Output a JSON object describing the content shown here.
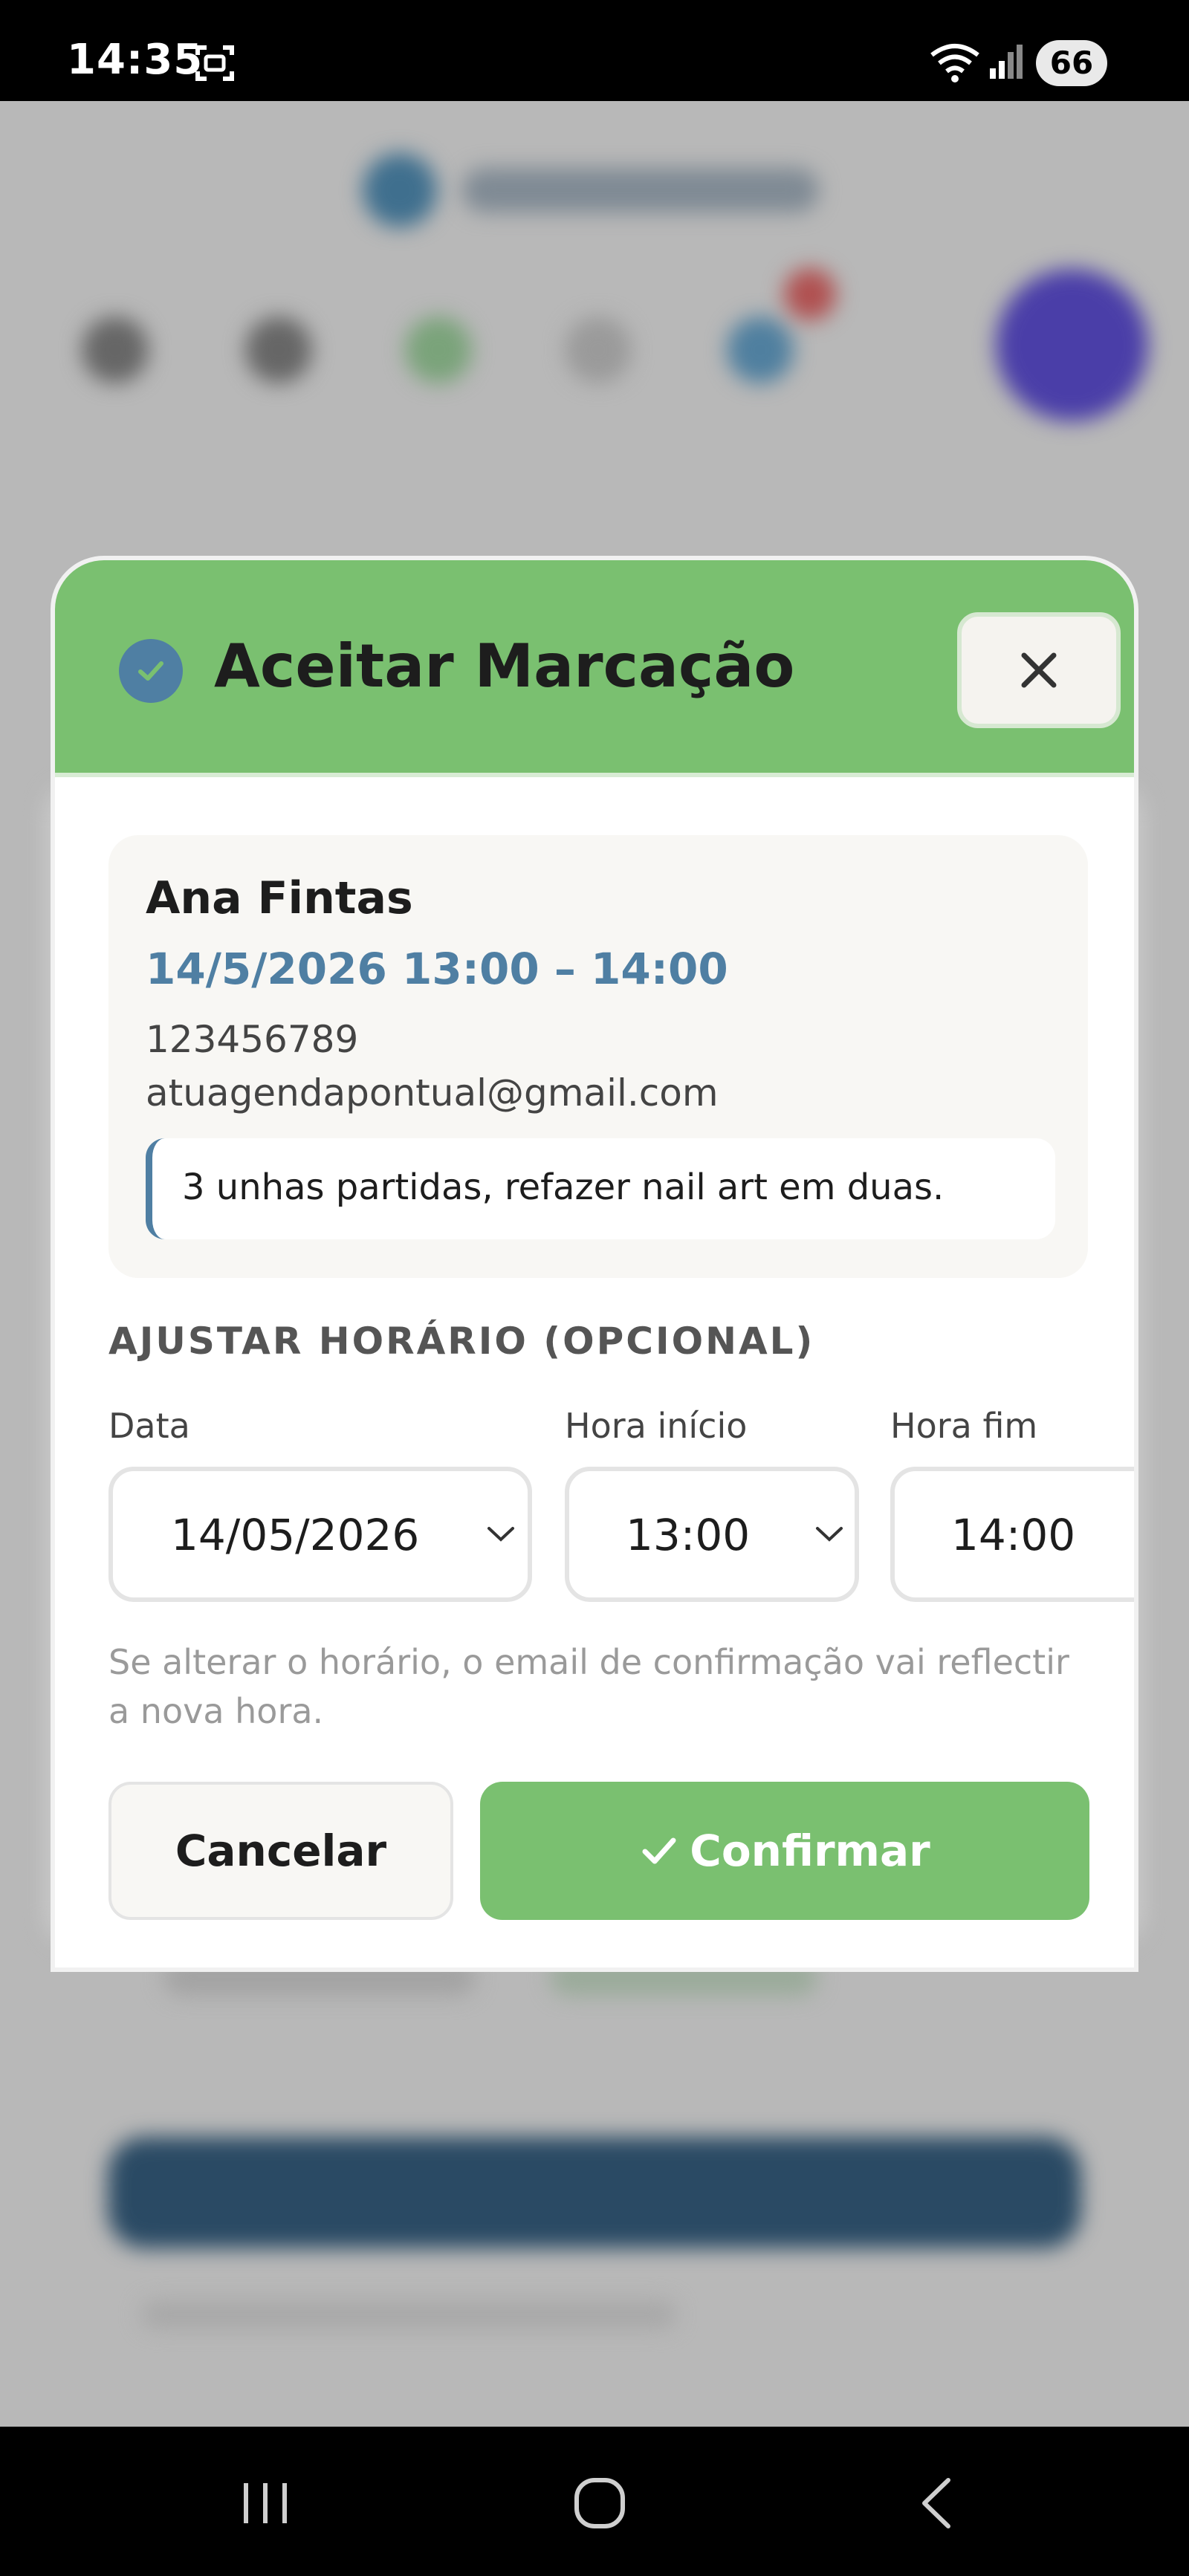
{
  "status_bar": {
    "time": "14:35",
    "battery": "66",
    "icons": [
      "screenshot-icon",
      "wifi-icon",
      "signal-icon"
    ]
  },
  "modal": {
    "title": "Aceitar Marcação",
    "header_icon": "check-circle-icon",
    "close_icon": "close-icon",
    "booking": {
      "client_name": "Ana Fintas",
      "datetime": "14/5/2026 13:00 – 14:00",
      "phone": "123456789",
      "email": "atuagendapontual@gmail.com",
      "notes": "3 unhas partidas, refazer nail art em duas."
    },
    "adjust": {
      "heading": "AJUSTAR HORÁRIO (OPCIONAL)",
      "date_label": "Data",
      "date_value": "14/05/2026",
      "start_label": "Hora início",
      "start_value": "13:00",
      "end_label": "Hora fim",
      "end_value": "14:00"
    },
    "helper_text": "Se alterar o horário, o email de confirmação vai reflectir a nova hora.",
    "cancel_label": "Cancelar",
    "confirm_label": "Confirmar"
  },
  "colors": {
    "header_green": "#7ac070",
    "accent_blue": "#4f7fa3",
    "confirm_green": "#7ac070"
  },
  "nav_bar": {
    "icons": [
      "recents-icon",
      "home-icon",
      "back-icon"
    ]
  }
}
